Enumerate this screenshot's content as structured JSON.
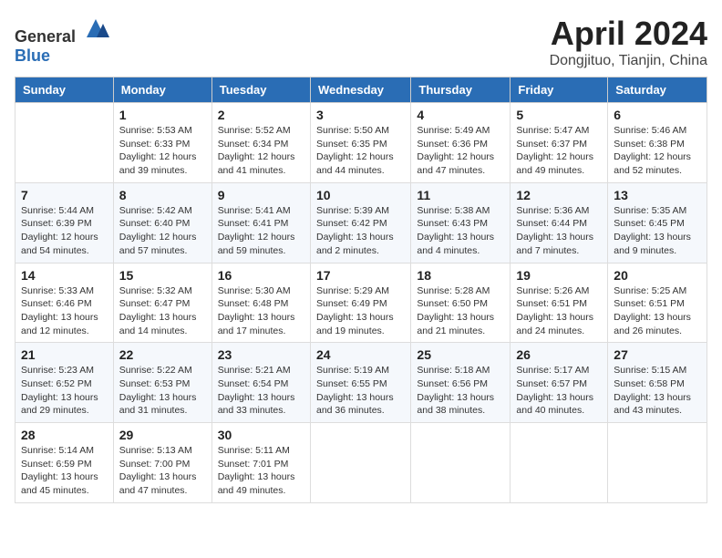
{
  "header": {
    "logo_general": "General",
    "logo_blue": "Blue",
    "month": "April 2024",
    "location": "Dongjituo, Tianjin, China"
  },
  "weekdays": [
    "Sunday",
    "Monday",
    "Tuesday",
    "Wednesday",
    "Thursday",
    "Friday",
    "Saturday"
  ],
  "weeks": [
    [
      {
        "day": "",
        "info": ""
      },
      {
        "day": "1",
        "info": "Sunrise: 5:53 AM\nSunset: 6:33 PM\nDaylight: 12 hours\nand 39 minutes."
      },
      {
        "day": "2",
        "info": "Sunrise: 5:52 AM\nSunset: 6:34 PM\nDaylight: 12 hours\nand 41 minutes."
      },
      {
        "day": "3",
        "info": "Sunrise: 5:50 AM\nSunset: 6:35 PM\nDaylight: 12 hours\nand 44 minutes."
      },
      {
        "day": "4",
        "info": "Sunrise: 5:49 AM\nSunset: 6:36 PM\nDaylight: 12 hours\nand 47 minutes."
      },
      {
        "day": "5",
        "info": "Sunrise: 5:47 AM\nSunset: 6:37 PM\nDaylight: 12 hours\nand 49 minutes."
      },
      {
        "day": "6",
        "info": "Sunrise: 5:46 AM\nSunset: 6:38 PM\nDaylight: 12 hours\nand 52 minutes."
      }
    ],
    [
      {
        "day": "7",
        "info": "Sunrise: 5:44 AM\nSunset: 6:39 PM\nDaylight: 12 hours\nand 54 minutes."
      },
      {
        "day": "8",
        "info": "Sunrise: 5:42 AM\nSunset: 6:40 PM\nDaylight: 12 hours\nand 57 minutes."
      },
      {
        "day": "9",
        "info": "Sunrise: 5:41 AM\nSunset: 6:41 PM\nDaylight: 12 hours\nand 59 minutes."
      },
      {
        "day": "10",
        "info": "Sunrise: 5:39 AM\nSunset: 6:42 PM\nDaylight: 13 hours\nand 2 minutes."
      },
      {
        "day": "11",
        "info": "Sunrise: 5:38 AM\nSunset: 6:43 PM\nDaylight: 13 hours\nand 4 minutes."
      },
      {
        "day": "12",
        "info": "Sunrise: 5:36 AM\nSunset: 6:44 PM\nDaylight: 13 hours\nand 7 minutes."
      },
      {
        "day": "13",
        "info": "Sunrise: 5:35 AM\nSunset: 6:45 PM\nDaylight: 13 hours\nand 9 minutes."
      }
    ],
    [
      {
        "day": "14",
        "info": "Sunrise: 5:33 AM\nSunset: 6:46 PM\nDaylight: 13 hours\nand 12 minutes."
      },
      {
        "day": "15",
        "info": "Sunrise: 5:32 AM\nSunset: 6:47 PM\nDaylight: 13 hours\nand 14 minutes."
      },
      {
        "day": "16",
        "info": "Sunrise: 5:30 AM\nSunset: 6:48 PM\nDaylight: 13 hours\nand 17 minutes."
      },
      {
        "day": "17",
        "info": "Sunrise: 5:29 AM\nSunset: 6:49 PM\nDaylight: 13 hours\nand 19 minutes."
      },
      {
        "day": "18",
        "info": "Sunrise: 5:28 AM\nSunset: 6:50 PM\nDaylight: 13 hours\nand 21 minutes."
      },
      {
        "day": "19",
        "info": "Sunrise: 5:26 AM\nSunset: 6:51 PM\nDaylight: 13 hours\nand 24 minutes."
      },
      {
        "day": "20",
        "info": "Sunrise: 5:25 AM\nSunset: 6:51 PM\nDaylight: 13 hours\nand 26 minutes."
      }
    ],
    [
      {
        "day": "21",
        "info": "Sunrise: 5:23 AM\nSunset: 6:52 PM\nDaylight: 13 hours\nand 29 minutes."
      },
      {
        "day": "22",
        "info": "Sunrise: 5:22 AM\nSunset: 6:53 PM\nDaylight: 13 hours\nand 31 minutes."
      },
      {
        "day": "23",
        "info": "Sunrise: 5:21 AM\nSunset: 6:54 PM\nDaylight: 13 hours\nand 33 minutes."
      },
      {
        "day": "24",
        "info": "Sunrise: 5:19 AM\nSunset: 6:55 PM\nDaylight: 13 hours\nand 36 minutes."
      },
      {
        "day": "25",
        "info": "Sunrise: 5:18 AM\nSunset: 6:56 PM\nDaylight: 13 hours\nand 38 minutes."
      },
      {
        "day": "26",
        "info": "Sunrise: 5:17 AM\nSunset: 6:57 PM\nDaylight: 13 hours\nand 40 minutes."
      },
      {
        "day": "27",
        "info": "Sunrise: 5:15 AM\nSunset: 6:58 PM\nDaylight: 13 hours\nand 43 minutes."
      }
    ],
    [
      {
        "day": "28",
        "info": "Sunrise: 5:14 AM\nSunset: 6:59 PM\nDaylight: 13 hours\nand 45 minutes."
      },
      {
        "day": "29",
        "info": "Sunrise: 5:13 AM\nSunset: 7:00 PM\nDaylight: 13 hours\nand 47 minutes."
      },
      {
        "day": "30",
        "info": "Sunrise: 5:11 AM\nSunset: 7:01 PM\nDaylight: 13 hours\nand 49 minutes."
      },
      {
        "day": "",
        "info": ""
      },
      {
        "day": "",
        "info": ""
      },
      {
        "day": "",
        "info": ""
      },
      {
        "day": "",
        "info": ""
      }
    ]
  ]
}
